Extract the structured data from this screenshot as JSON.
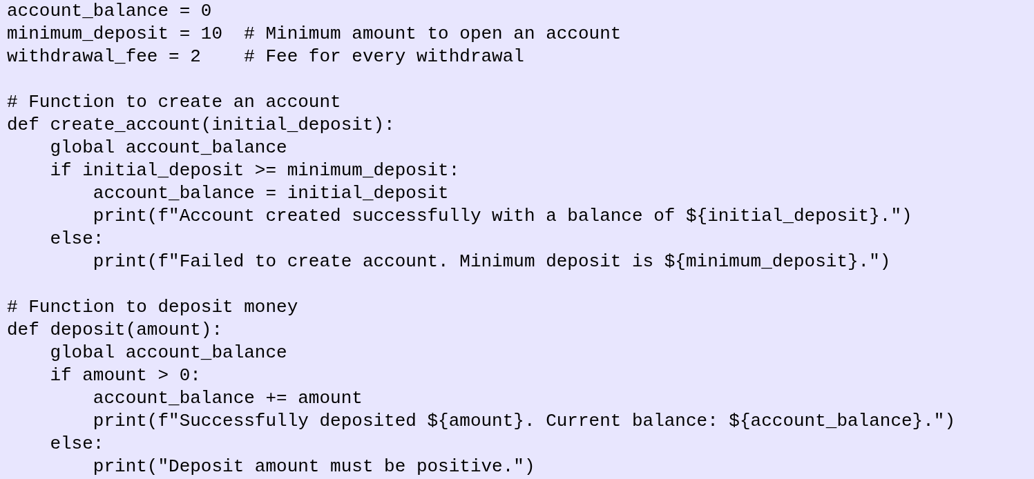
{
  "code_blocks": [
    {
      "lines": [
        "account_balance = 0",
        "minimum_deposit = 10  # Minimum amount to open an account",
        "withdrawal_fee = 2    # Fee for every withdrawal"
      ]
    },
    {
      "lines": [
        "# Function to create an account",
        "def create_account(initial_deposit):",
        "    global account_balance",
        "    if initial_deposit >= minimum_deposit:",
        "        account_balance = initial_deposit",
        "        print(f\"Account created successfully with a balance of ${initial_deposit}.\")",
        "    else:",
        "        print(f\"Failed to create account. Minimum deposit is ${minimum_deposit}.\")"
      ]
    },
    {
      "lines": [
        "# Function to deposit money",
        "def deposit(amount):",
        "    global account_balance",
        "    if amount > 0:",
        "        account_balance += amount",
        "        print(f\"Successfully deposited ${amount}. Current balance: ${account_balance}.\")",
        "    else:",
        "        print(\"Deposit amount must be positive.\")"
      ]
    }
  ]
}
